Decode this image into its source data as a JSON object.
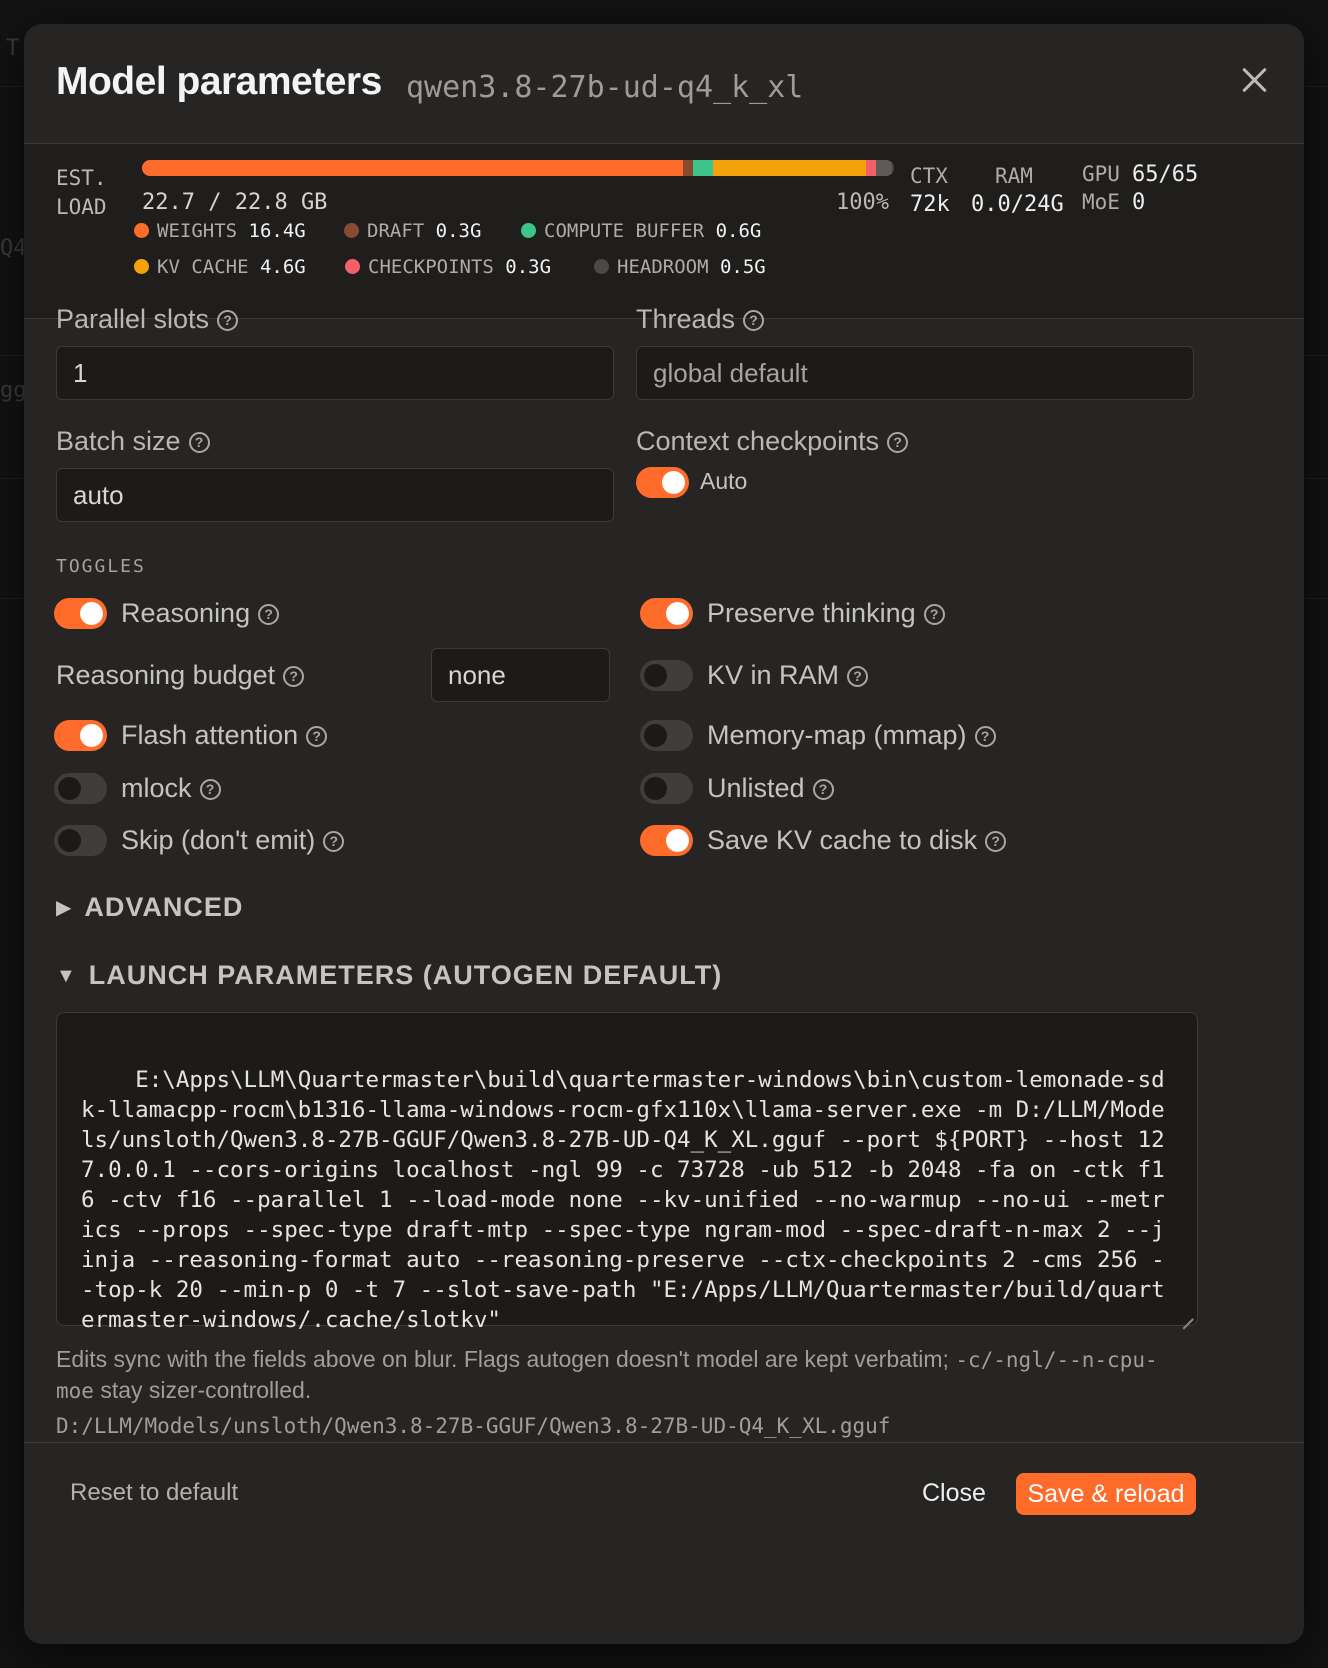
{
  "modal": {
    "title": "Model parameters",
    "model_id": "qwen3.8-27b-ud-q4_k_xl",
    "close_icon": "close-icon"
  },
  "load": {
    "est_line1": "EST.",
    "est_line2": "LOAD",
    "value": "22.7 / 22.8 GB",
    "percent": "100%",
    "segments": [
      {
        "name": "weights",
        "fraction": 0.72,
        "color": "#ff6b2b"
      },
      {
        "name": "draft",
        "fraction": 0.013,
        "color": "#8a4a32"
      },
      {
        "name": "compute",
        "fraction": 0.026,
        "color": "#3cc48a"
      },
      {
        "name": "kv",
        "fraction": 0.204,
        "color": "#f3a20c"
      },
      {
        "name": "checkpoints",
        "fraction": 0.013,
        "color": "#f4606a"
      },
      {
        "name": "headroom",
        "fraction": 0.022,
        "color": "#5c5b58"
      }
    ],
    "legend": [
      {
        "label": "WEIGHTS",
        "value": "16.4G",
        "color": "#ff6b2b"
      },
      {
        "label": "DRAFT",
        "value": "0.3G",
        "color": "#8a4a32"
      },
      {
        "label": "COMPUTE BUFFER",
        "value": "0.6G",
        "color": "#3cc48a"
      },
      {
        "label": "KV CACHE",
        "value": "4.6G",
        "color": "#f3a20c"
      },
      {
        "label": "CHECKPOINTS",
        "value": "0.3G",
        "color": "#f4606a"
      },
      {
        "label": "HEADROOM",
        "value": "0.5G",
        "color": "#4a4946"
      }
    ],
    "ctx_label": "CTX",
    "ctx_value": "72k",
    "ram_label": "RAM",
    "ram_value": "0.0/24G",
    "gpu_label": "GPU",
    "gpu_value": "65/65",
    "moe_label": "MoE",
    "moe_value": "0"
  },
  "fields": {
    "parallel_label": "Parallel slots",
    "parallel_value": "1",
    "threads_label": "Threads",
    "threads_placeholder": "global default",
    "batch_label": "Batch size",
    "batch_value": "auto",
    "checkpoints_label": "Context checkpoints",
    "checkpoints_toggle_label": "Auto"
  },
  "toggles_caption": "TOGGLES",
  "toggles": {
    "reasoning": "Reasoning",
    "reasoning_budget": "Reasoning budget",
    "reasoning_budget_value": "none",
    "flash_attention": "Flash attention",
    "mlock": "mlock",
    "skip": "Skip (don't emit)",
    "preserve_thinking": "Preserve thinking",
    "kv_in_ram": "KV in RAM",
    "mmap": "Memory-map (mmap)",
    "unlisted": "Unlisted",
    "save_kv": "Save KV cache to disk"
  },
  "advanced_label": "ADVANCED",
  "launch_label": "LAUNCH PARAMETERS (AUTOGEN DEFAULT)",
  "command": "E:\\Apps\\LLM\\Quartermaster\\build\\quartermaster-windows\\bin\\custom-lemonade-sdk-llamacpp-rocm\\b1316-llama-windows-rocm-gfx110x\\llama-server.exe -m D:/LLM/Models/unsloth/Qwen3.8-27B-GGUF/Qwen3.8-27B-UD-Q4_K_XL.gguf --port ${PORT} --host 127.0.0.1 --cors-origins localhost -ngl 99 -c 73728 -ub 512 -b 2048 -fa on -ctk f16 -ctv f16 --parallel 1 --load-mode none --kv-unified --no-warmup --no-ui --metrics --props --spec-type draft-mtp --spec-type ngram-mod --spec-draft-n-max 2 --jinja --reasoning-format auto --reasoning-preserve --ctx-checkpoints 2 -cms 256 --top-k 20 --min-p 0 -t 7 --slot-save-path \"E:/Apps/LLM/Quartermaster/build/quartermaster-windows/.cache/slotkv\"",
  "help": {
    "text_before": "Edits sync with the fields above on blur. Flags autogen doesn't model are kept verbatim; ",
    "flags": "-c/-ngl/--n-cpu-moe",
    "text_after": " stay sizer-controlled."
  },
  "model_path": "D:/LLM/Models/unsloth/Qwen3.8-27B-GGUF/Qwen3.8-27B-UD-Q4_K_XL.gguf",
  "footer": {
    "reset": "Reset to default",
    "close": "Close",
    "save": "Save & reload"
  },
  "colors": {
    "accent": "#ff6b2b",
    "modal_bg": "#262523"
  }
}
